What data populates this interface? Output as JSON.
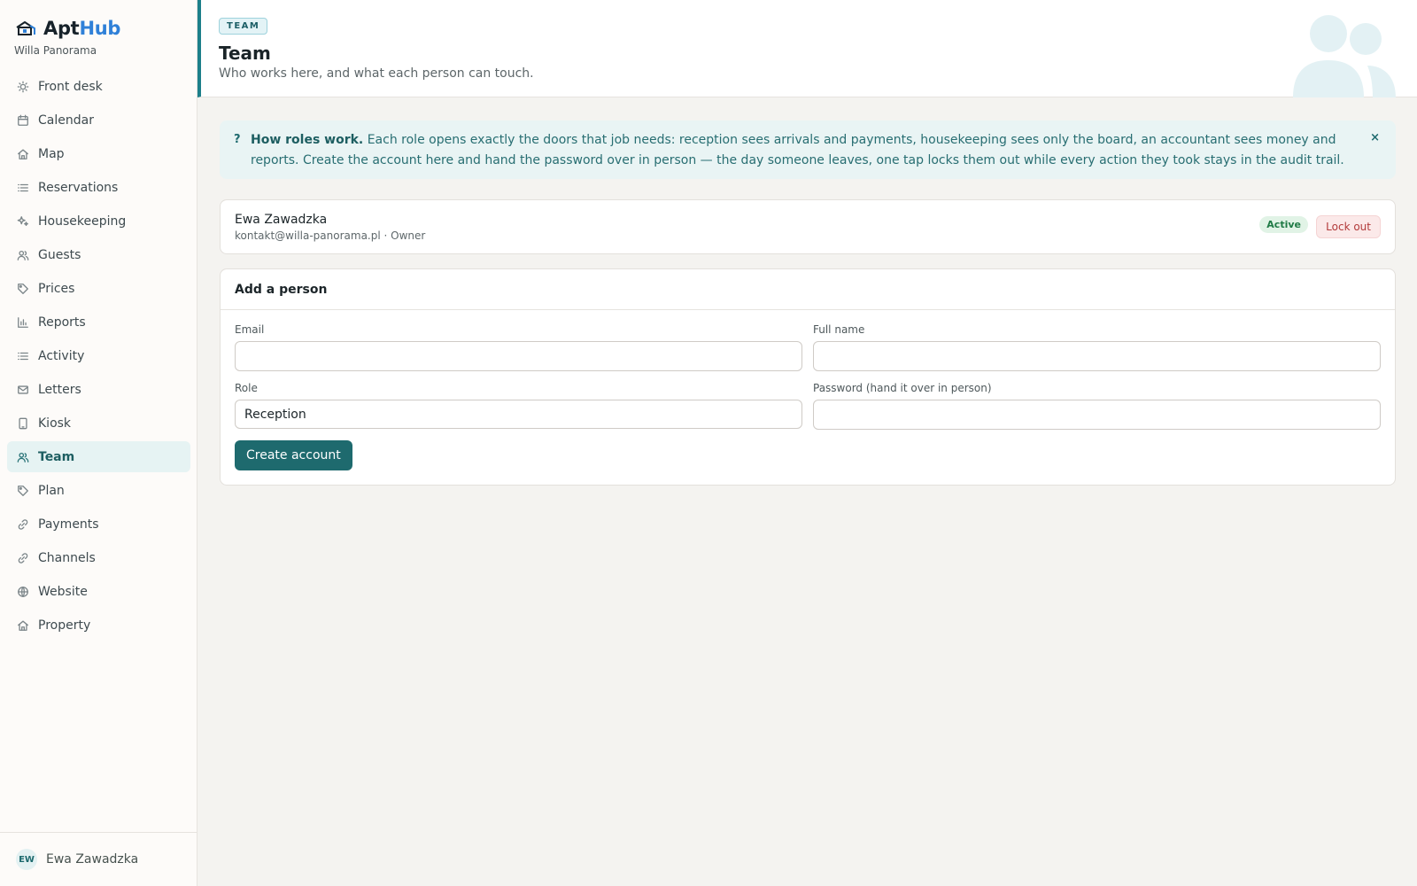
{
  "app": {
    "name_part1": "Apt",
    "name_part2": "Hub",
    "property": "Willa Panorama"
  },
  "sidebar": {
    "items": [
      {
        "label": "Front desk",
        "icon": "sun-icon"
      },
      {
        "label": "Calendar",
        "icon": "calendar-icon"
      },
      {
        "label": "Map",
        "icon": "home-icon"
      },
      {
        "label": "Reservations",
        "icon": "list-icon"
      },
      {
        "label": "Housekeeping",
        "icon": "sparkle-icon"
      },
      {
        "label": "Guests",
        "icon": "users-icon"
      },
      {
        "label": "Prices",
        "icon": "tag-icon"
      },
      {
        "label": "Reports",
        "icon": "bar-chart-icon"
      },
      {
        "label": "Activity",
        "icon": "list-icon"
      },
      {
        "label": "Letters",
        "icon": "mail-icon"
      },
      {
        "label": "Kiosk",
        "icon": "tablet-icon"
      },
      {
        "label": "Team",
        "icon": "users-icon",
        "active": true
      },
      {
        "label": "Plan",
        "icon": "tag-icon"
      },
      {
        "label": "Payments",
        "icon": "link-icon"
      },
      {
        "label": "Channels",
        "icon": "link-icon"
      },
      {
        "label": "Website",
        "icon": "globe-icon"
      },
      {
        "label": "Property",
        "icon": "home-icon"
      }
    ],
    "user": {
      "initials": "EW",
      "name": "Ewa Zawadzka"
    }
  },
  "header": {
    "badge": "TEAM",
    "title": "Team",
    "subtitle": "Who works here, and what each person can touch."
  },
  "info": {
    "icon": "?",
    "title": "How roles work.",
    "text": " Each role opens exactly the doors that job needs: reception sees arrivals and payments, housekeeping sees only the board, an accountant sees money and reports. Create the account here and hand the password over in person — the day someone leaves, one tap locks them out while every action they took stays in the audit trail.",
    "close": "×"
  },
  "members": [
    {
      "name": "Ewa Zawadzka",
      "meta": "kontakt@willa-panorama.pl · Owner",
      "status": "Active",
      "action": "Lock out"
    }
  ],
  "add_form": {
    "title": "Add a person",
    "email_label": "Email",
    "email_value": "",
    "fullname_label": "Full name",
    "fullname_value": "",
    "role_label": "Role",
    "role_value": "Reception",
    "password_label": "Password (hand it over in person)",
    "password_value": "",
    "submit": "Create account"
  },
  "colors": {
    "accent": "#1e6a6e",
    "brand_blue": "#2f80d8",
    "active_green": "#1f7a45",
    "danger": "#b23a3a"
  }
}
